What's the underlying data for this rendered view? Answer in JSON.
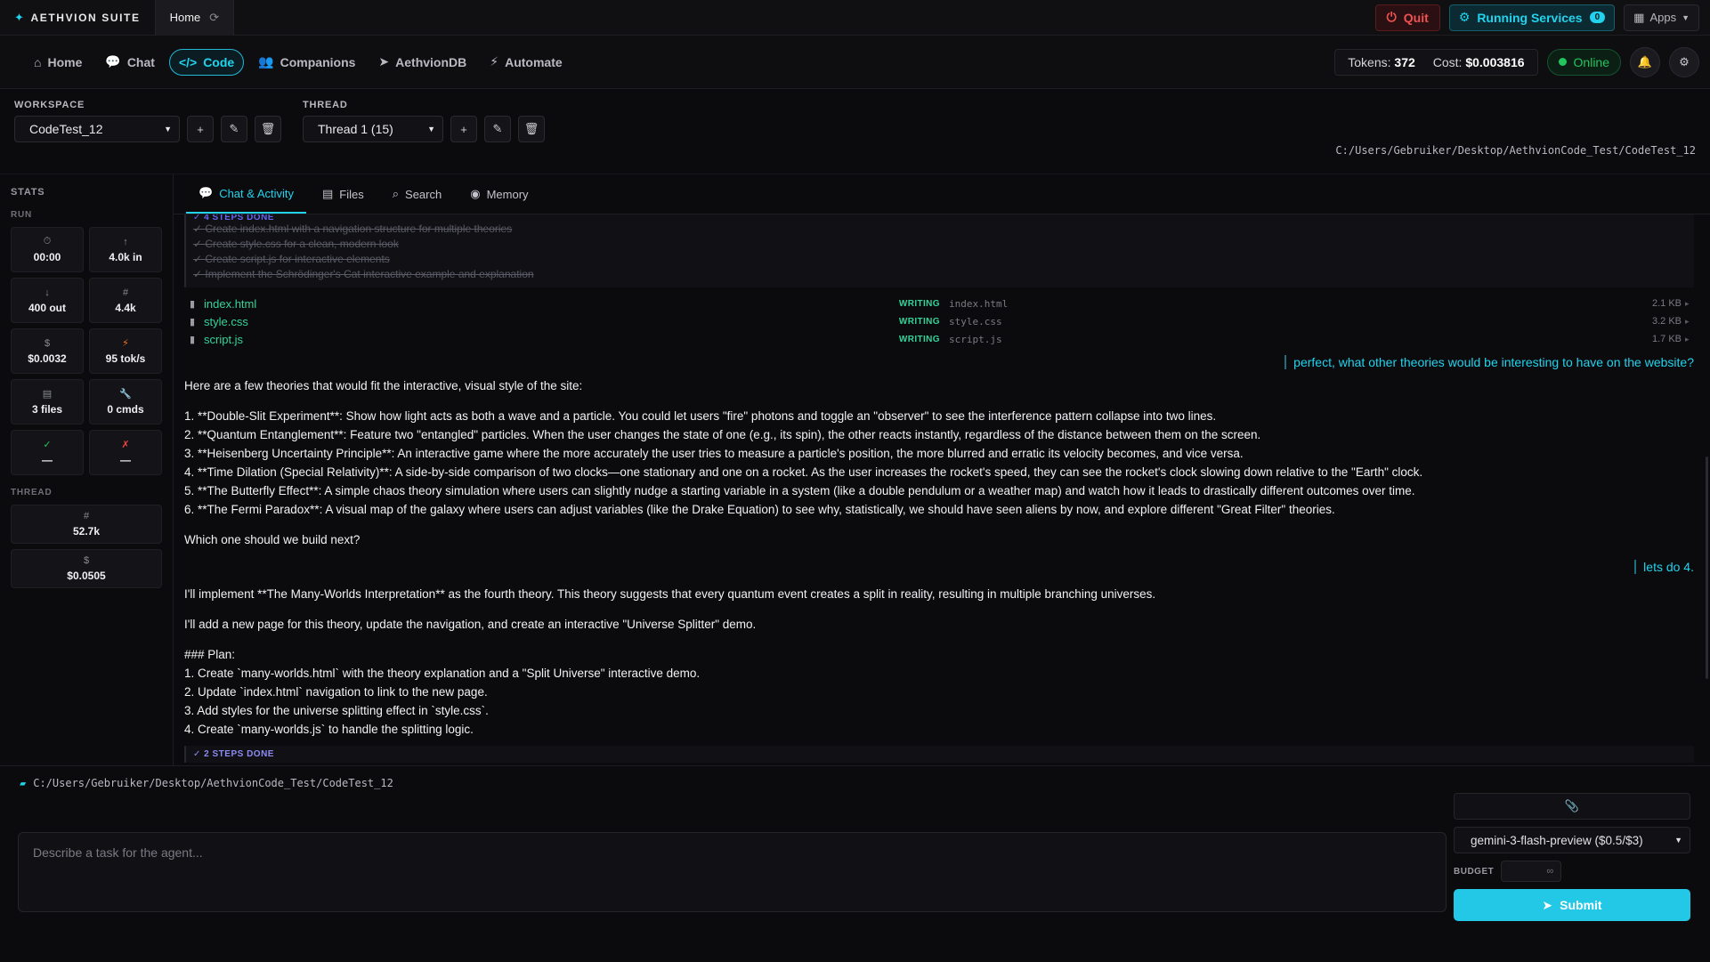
{
  "topbar": {
    "brand": "AETHVION SUITE",
    "home_tab": "Home",
    "quit": "Quit",
    "running_services": "Running Services",
    "running_count": "0",
    "apps": "Apps"
  },
  "nav": {
    "items": [
      {
        "label": "Home",
        "icon": "home-icon"
      },
      {
        "label": "Chat",
        "icon": "chat-icon"
      },
      {
        "label": "Code",
        "icon": "code-icon",
        "active": true
      },
      {
        "label": "Companions",
        "icon": "users-icon"
      },
      {
        "label": "AethvionDB",
        "icon": "send-icon"
      },
      {
        "label": "Automate",
        "icon": "bolt-icon"
      }
    ],
    "tokens_label": "Tokens:",
    "tokens_value": "372",
    "cost_label": "Cost:",
    "cost_value": "$0.003816",
    "status": "Online"
  },
  "workspace": {
    "label": "WORKSPACE",
    "selected": "CodeTest_12",
    "thread_label": "THREAD",
    "thread_selected": "Thread 1 (15)",
    "path": "C:/Users/Gebruiker/Desktop/AethvionCode_Test/CodeTest_12"
  },
  "sidebar": {
    "title": "STATS",
    "run_label": "RUN",
    "run": [
      {
        "icon": "clock-icon",
        "glyph": "⏱",
        "value": "00:00"
      },
      {
        "icon": "arrow-up-icon",
        "glyph": "↑",
        "value": "4.0k in"
      },
      {
        "icon": "arrow-down-icon",
        "glyph": "↓",
        "value": "400 out"
      },
      {
        "icon": "hash-icon",
        "glyph": "#",
        "value": "4.4k"
      },
      {
        "icon": "dollar-icon",
        "glyph": "$",
        "value": "$0.0032"
      },
      {
        "icon": "bolt-icon",
        "glyph": "⚡",
        "value": "95 tok/s"
      },
      {
        "icon": "file-icon",
        "glyph": "▤",
        "value": "3 files"
      },
      {
        "icon": "wrench-icon",
        "glyph": "🔧",
        "value": "0 cmds"
      },
      {
        "icon": "check-icon",
        "glyph": "✓",
        "value": "—"
      },
      {
        "icon": "x-icon",
        "glyph": "✗",
        "value": "—"
      }
    ],
    "thread_label": "THREAD",
    "thread": [
      {
        "icon": "hash-icon",
        "glyph": "#",
        "value": "52.7k"
      },
      {
        "icon": "dollar-icon",
        "glyph": "$",
        "value": "$0.0505"
      }
    ]
  },
  "tabs": [
    {
      "label": "Chat & Activity",
      "icon": "chat-icon",
      "active": true
    },
    {
      "label": "Files",
      "icon": "files-icon"
    },
    {
      "label": "Search",
      "icon": "search-icon"
    },
    {
      "label": "Memory",
      "icon": "brain-icon"
    }
  ],
  "feed": {
    "steps_header": "✓ 4 STEPS DONE",
    "steps": [
      "✓ Create index.html with a navigation structure for multiple theories",
      "✓ Create style.css for a clean, modern look",
      "✓ Create script.js for interactive elements",
      "✓ Implement the Schrödinger's Cat interactive example and explanation"
    ],
    "files": [
      {
        "name": "index.html",
        "tag": "WRITING",
        "path": "index.html",
        "size": "2.1 KB"
      },
      {
        "name": "style.css",
        "tag": "WRITING",
        "path": "style.css",
        "size": "3.2 KB"
      },
      {
        "name": "script.js",
        "tag": "WRITING",
        "path": "script.js",
        "size": "1.7 KB"
      }
    ],
    "user1": "perfect, what other theories would be interesting to have on the website?",
    "reply1": [
      "Here are a few theories that would fit the interactive, visual style of the site:",
      "",
      "1.  **Double-Slit Experiment**: Show how light acts as both a wave and a particle. You could let users \"fire\" photons and toggle an \"observer\" to see the interference pattern collapse into two lines.",
      "2.  **Quantum Entanglement**: Feature two \"entangled\" particles. When the user changes the state of one (e.g., its spin), the other reacts instantly, regardless of the distance between them on the screen.",
      "3.  **Heisenberg Uncertainty Principle**: An interactive game where the more accurately the user tries to measure a particle's position, the more blurred and erratic its velocity becomes, and vice versa.",
      "4.  **Time Dilation (Special Relativity)**: A side-by-side comparison of two clocks—one stationary and one on a rocket. As the user increases the rocket's speed, they can see the rocket's clock slowing down relative to the \"Earth\" clock.",
      "5.  **The Butterfly Effect**: A simple chaos theory simulation where users can slightly nudge a starting variable in a system (like a double pendulum or a weather map) and watch how it leads to drastically different outcomes over time.",
      "6.  **The Fermi Paradox**: A visual map of the galaxy where users can adjust variables (like the Drake Equation) to see why, statistically, we should have seen aliens by now, and explore different \"Great Filter\" theories.",
      "",
      "Which one should we build next?"
    ],
    "user2": "lets do 4.",
    "reply2": [
      "I'll implement **The Many-Worlds Interpretation** as the fourth theory. This theory suggests that every quantum event creates a split in reality, resulting in multiple branching universes.",
      "",
      "I'll add a new page for this theory, update the navigation, and create an interactive \"Universe Splitter\" demo.",
      "",
      "### Plan:",
      "1. Create `many-worlds.html` with the theory explanation and a \"Split Universe\" interactive demo.",
      "2. Update `index.html` navigation to link to the new page.",
      "3. Add styles for the universe splitting effect in `style.css`.",
      "4. Create `many-worlds.js` to handle the splitting logic."
    ],
    "steps2_header": "✓ 2 STEPS DONE"
  },
  "composer": {
    "path": "C:/Users/Gebruiker/Desktop/AethvionCode_Test/CodeTest_12",
    "placeholder": "Describe a task for the agent...",
    "model": "gemini-3-flash-preview ($0.5/$3)",
    "budget_label": "BUDGET",
    "budget_value": "∞",
    "submit": "Submit"
  },
  "colors": {
    "accent": "#22d3ee",
    "success": "#22c55e",
    "danger": "#f05252",
    "file_green": "#34d399",
    "background": "#0b0b0d"
  }
}
